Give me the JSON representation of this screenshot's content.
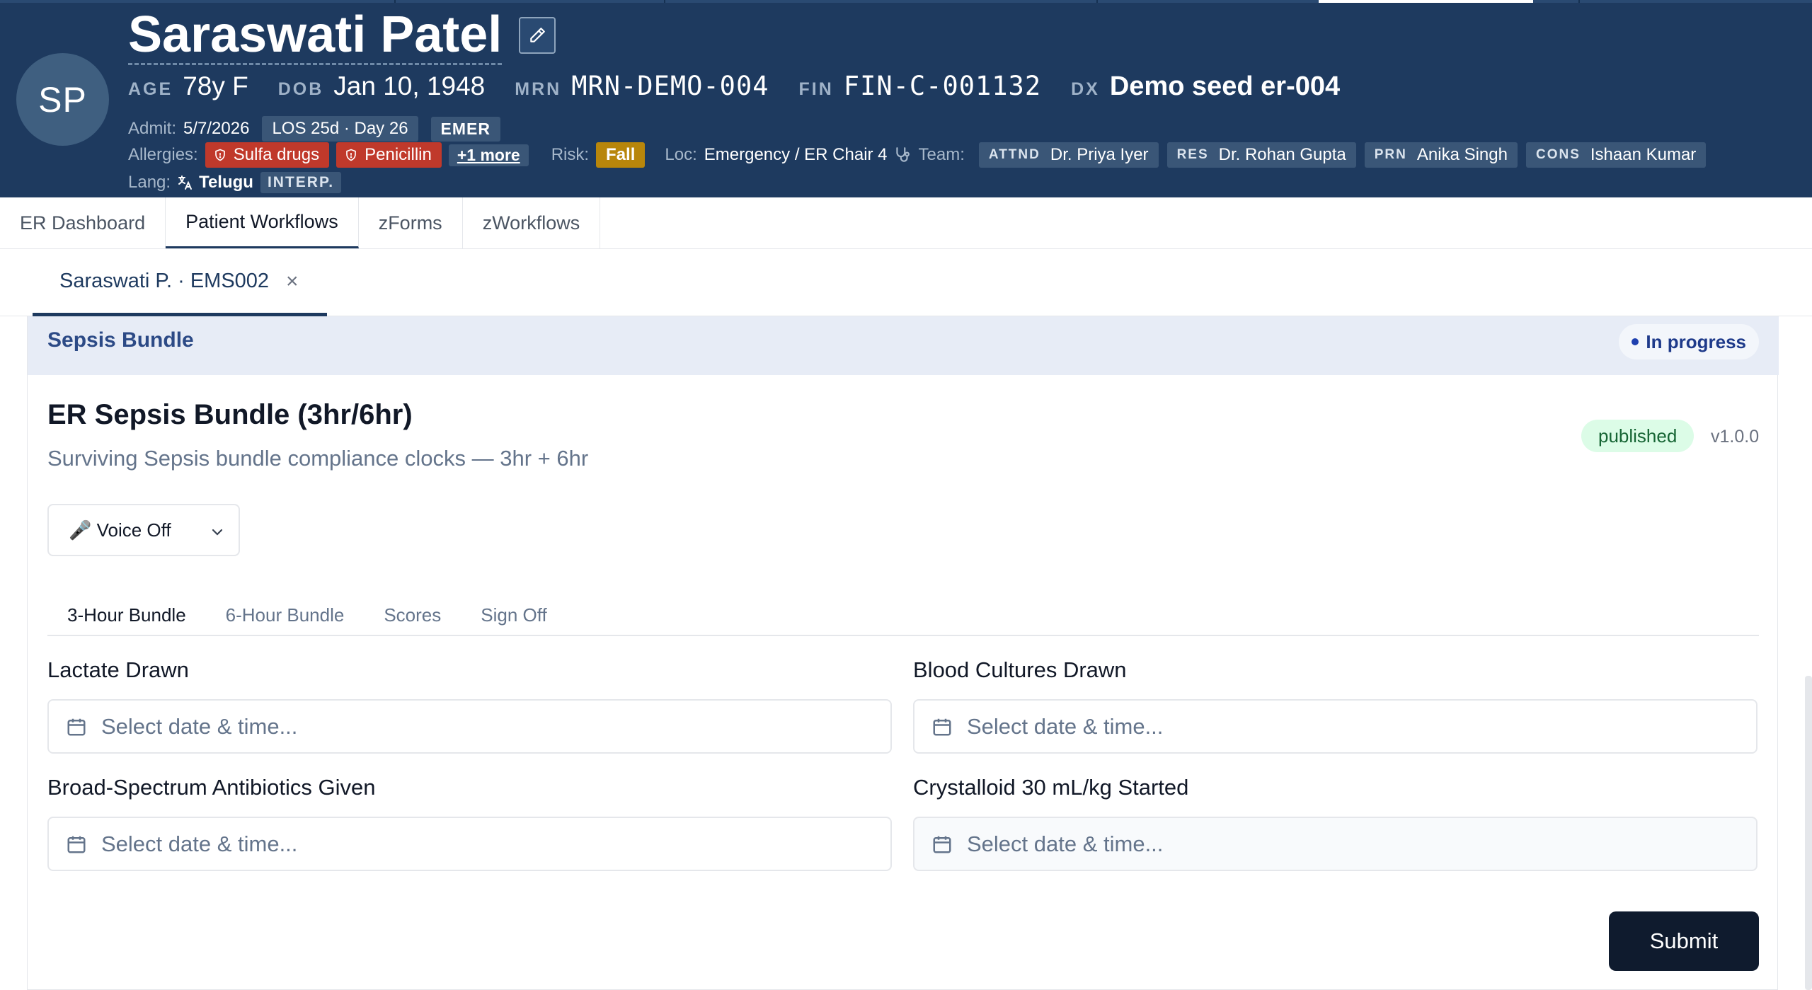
{
  "patient": {
    "initials": "SP",
    "name": "Saraswati Patel",
    "age_label": "AGE",
    "age": "78y F",
    "dob_label": "DOB",
    "dob": "Jan 10, 1948",
    "mrn_label": "MRN",
    "mrn": "MRN-DEMO-004",
    "fin_label": "FIN",
    "fin": "FIN-C-001132",
    "dx_label": "DX",
    "dx": "Demo seed er-004"
  },
  "encounter": {
    "admit_label": "Admit:",
    "admit": "5/7/2026",
    "los": "LOS 25d · Day 26",
    "type": "EMER",
    "allergies_label": "Allergies:",
    "allergies": [
      "Sulfa drugs",
      "Penicillin"
    ],
    "more": "+1 more",
    "risk_label": "Risk:",
    "risk": "Fall",
    "loc_label": "Loc:",
    "loc": "Emergency / ER Chair 4",
    "team_label": "Team:",
    "team": [
      {
        "role": "ATTND",
        "name": "Dr. Priya Iyer"
      },
      {
        "role": "RES",
        "name": "Dr. Rohan Gupta"
      },
      {
        "role": "PRN",
        "name": "Anika Singh"
      },
      {
        "role": "CONS",
        "name": "Ishaan Kumar"
      }
    ],
    "lang_label": "Lang:",
    "lang": "Telugu",
    "interp": "INTERP."
  },
  "nav": {
    "tabs": [
      "ER Dashboard",
      "Patient Workflows",
      "zForms",
      "zWorkflows"
    ],
    "active": "Patient Workflows"
  },
  "patient_tab": {
    "label": "Saraswati P. · EMS002",
    "close": "×"
  },
  "bundle": {
    "section_title": "Sepsis Bundle",
    "status": "In progress",
    "title": "ER Sepsis Bundle (3hr/6hr)",
    "subtitle": "Surviving Sepsis bundle compliance clocks — 3hr + 6hr",
    "publish_state": "published",
    "version": "v1.0.0",
    "voice": "🎤 Voice Off",
    "tabs": [
      "3-Hour Bundle",
      "6-Hour Bundle",
      "Scores",
      "Sign Off"
    ],
    "active_tab": "3-Hour Bundle",
    "fields": [
      {
        "label": "Lactate Drawn",
        "placeholder": "Select date & time..."
      },
      {
        "label": "Blood Cultures Drawn",
        "placeholder": "Select date & time..."
      },
      {
        "label": "Broad-Spectrum Antibiotics Given",
        "placeholder": "Select date & time..."
      },
      {
        "label": "Crystalloid 30 mL/kg Started",
        "placeholder": "Select date & time..."
      }
    ],
    "submit": "Submit"
  },
  "colors": {
    "header_bg": "#1e3a5f",
    "allergy": "#c0392b",
    "risk": "#b8860b",
    "submit_bg": "#0f1b2e"
  }
}
